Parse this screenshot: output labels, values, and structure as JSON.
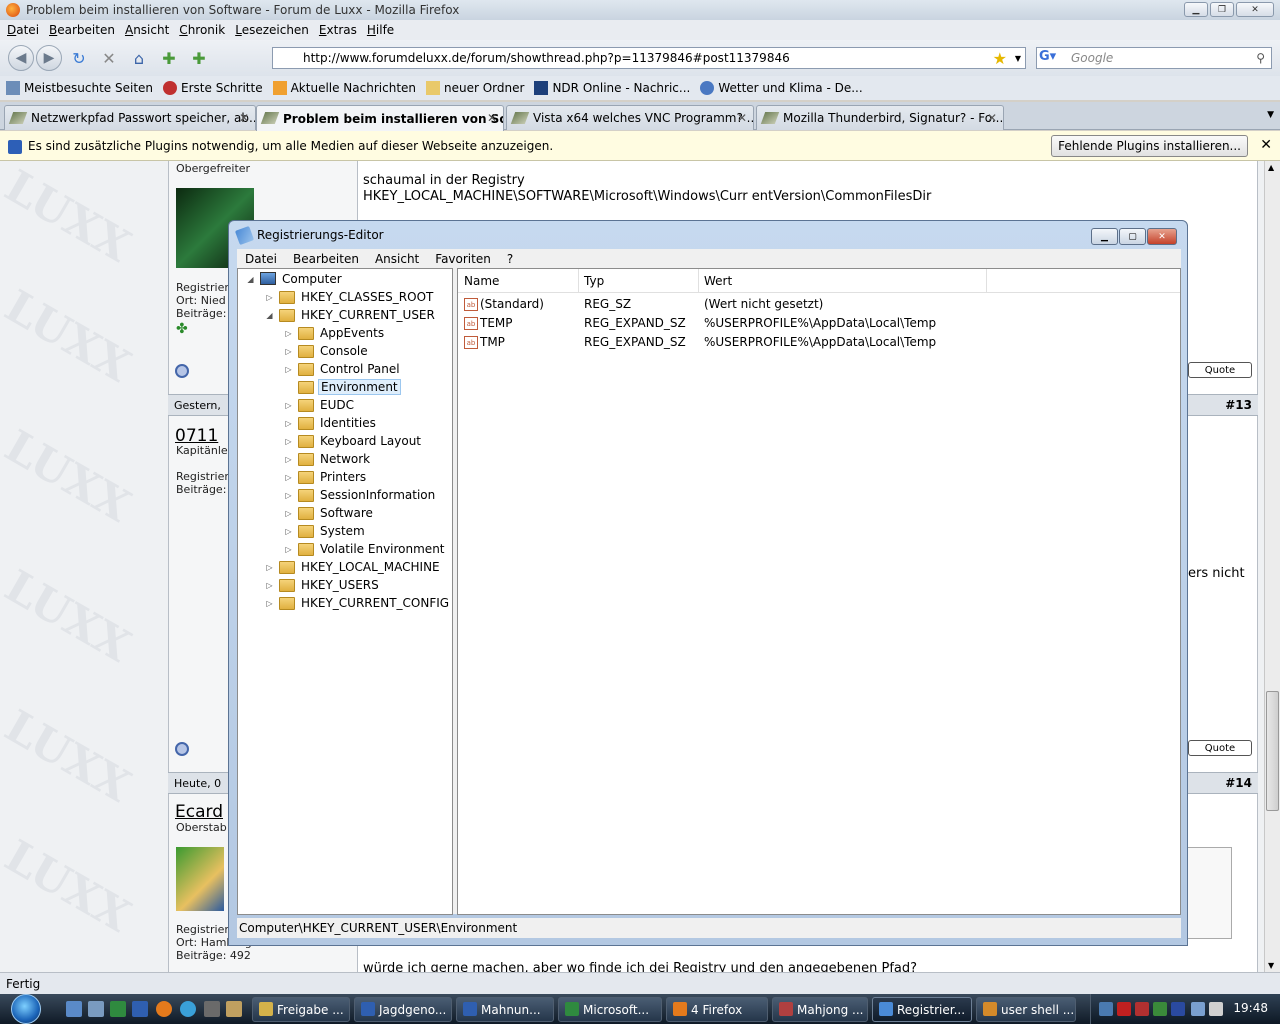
{
  "firefox": {
    "title": "Problem beim installieren von Software - Forum de Luxx - Mozilla Firefox",
    "menu": [
      "Datei",
      "Bearbeiten",
      "Ansicht",
      "Chronik",
      "Lesezeichen",
      "Extras",
      "Hilfe"
    ],
    "url": "http://www.forumdeluxx.de/forum/showthread.php?p=11379846#post11379846",
    "search_placeholder": "Google",
    "bookmarks": [
      "Meistbesuchte Seiten",
      "Erste Schritte",
      "Aktuelle Nachrichten",
      "neuer Ordner",
      "NDR Online - Nachric...",
      "Wetter und Klima - De..."
    ],
    "tabs": [
      {
        "label": "Netzwerkpfad Passwort speicher, ab...",
        "active": false
      },
      {
        "label": "Problem beim installieren von So...",
        "active": true
      },
      {
        "label": "Vista x64 welches VNC Programm? ...",
        "active": false
      },
      {
        "label": "Mozilla Thunderbird, Signatur? - Fo...",
        "active": false
      }
    ],
    "plugin_bar": {
      "message": "Es sind zusätzliche Plugins notwendig, um alle Medien auf dieser Webseite anzuzeigen.",
      "button": "Fehlende Plugins installieren..."
    },
    "status": "Fertig"
  },
  "forum": {
    "rank1": "Obergefreiter",
    "reg1": "Registrier",
    "ort1": "Ort: Nied",
    "beitraege1": "Beiträge:",
    "post_text_1": "schaumal in der Registry",
    "post_text_2": "HKEY_LOCAL_MACHINE\\SOFTWARE\\Microsoft\\Windows\\Curr entVersion\\CommonFilesDir",
    "quote": "Quote",
    "head2_date": "Gestern,",
    "head2_num": "#13",
    "user2": "0711",
    "rank2": "Kapitänle",
    "reg2": "Registrier",
    "beitraege2": "Beiträge:",
    "side_text": "ers nicht",
    "head3_date": "Heute, 0",
    "head3_num": "#14",
    "user3": "Ecard",
    "rank3": "Oberstab",
    "reg3": "Registrier",
    "ort3": "Ort: Hamburg",
    "beitraege3": "Beiträge: 492",
    "bottom_text": "würde ich gerne machen, aber wo finde ich dei Registry und den angegebenen Pfad?",
    "watermark": "LUXX"
  },
  "regedit": {
    "title": "Registrierungs-Editor",
    "menu": [
      "Datei",
      "Bearbeiten",
      "Ansicht",
      "Favoriten",
      "?"
    ],
    "tree": {
      "root": "Computer",
      "hkcr": "HKEY_CLASSES_ROOT",
      "hkcu": "HKEY_CURRENT_USER",
      "hkcu_children": [
        "AppEvents",
        "Console",
        "Control Panel",
        "Environment",
        "EUDC",
        "Identities",
        "Keyboard Layout",
        "Network",
        "Printers",
        "SessionInformation",
        "Software",
        "System",
        "Volatile Environment"
      ],
      "hklm": "HKEY_LOCAL_MACHINE",
      "hku": "HKEY_USERS",
      "hkcc": "HKEY_CURRENT_CONFIG"
    },
    "columns": [
      "Name",
      "Typ",
      "Wert"
    ],
    "values": [
      {
        "name": "(Standard)",
        "type": "REG_SZ",
        "data": "(Wert nicht gesetzt)"
      },
      {
        "name": "TEMP",
        "type": "REG_EXPAND_SZ",
        "data": "%USERPROFILE%\\AppData\\Local\\Temp"
      },
      {
        "name": "TMP",
        "type": "REG_EXPAND_SZ",
        "data": "%USERPROFILE%\\AppData\\Local\\Temp"
      }
    ],
    "status": "Computer\\HKEY_CURRENT_USER\\Environment"
  },
  "taskbar": {
    "buttons": [
      "Freigabe ...",
      "Jagdgeno...",
      "Mahnun...",
      "Microsoft...",
      "4 Firefox",
      "Mahjong ...",
      "Registrier...",
      "user shell ..."
    ],
    "clock": "19:48"
  }
}
